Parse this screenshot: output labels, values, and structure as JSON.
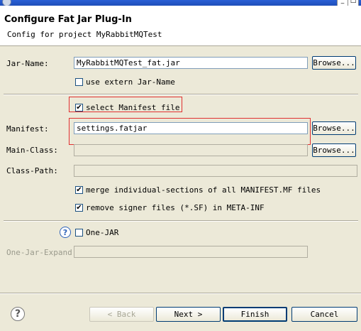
{
  "window": {
    "minimize_glyph": "_",
    "maximize_glyph": "□"
  },
  "header": {
    "title": "Configure Fat Jar Plug-In",
    "subtitle": "Config for project MyRabbitMQTest"
  },
  "form": {
    "jar_name_label": "Jar-Name:",
    "jar_name_value": "MyRabbitMQTest_fat.jar",
    "use_extern_label": "use extern Jar-Name",
    "use_extern_checked": false,
    "select_manifest_label": "select Manifest file",
    "select_manifest_checked": true,
    "manifest_label": "Manifest:",
    "manifest_value": "settings.fatjar",
    "main_class_label": "Main-Class:",
    "main_class_value": "",
    "class_path_label": "Class-Path:",
    "class_path_value": "",
    "merge_label": "merge individual-sections of all MANIFEST.MF files",
    "merge_checked": true,
    "remove_signer_label": "remove signer files (*.SF) in META-INF",
    "remove_signer_checked": true,
    "one_jar_label": "One-JAR",
    "one_jar_checked": false,
    "one_jar_expand_label": "One-Jar-Expand:",
    "one_jar_expand_value": "",
    "browse_label": "Browse...",
    "check_glyph": "✔",
    "help_glyph": "?"
  },
  "footer": {
    "back_label": "< Back",
    "next_label": "Next >",
    "finish_label": "Finish",
    "cancel_label": "Cancel"
  },
  "colors": {
    "annotation_red": "#e03030",
    "panel_bg": "#ece9d8"
  }
}
